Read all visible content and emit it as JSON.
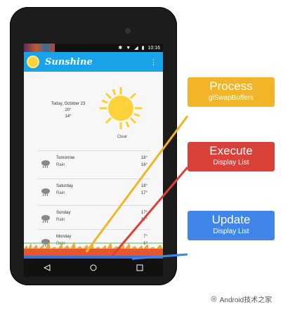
{
  "status": {
    "time": "10:16"
  },
  "app": {
    "title": "Sunshine",
    "menu_icon": "overflow-menu-icon"
  },
  "today": {
    "date": "Today, October 23",
    "high": "20°",
    "low": "14°",
    "condition": "Clear"
  },
  "forecast": [
    {
      "day": "Tomorrow",
      "desc": "Rain",
      "high": "18°",
      "low": "16°"
    },
    {
      "day": "Saturday",
      "desc": "Rain",
      "high": "18°",
      "low": "17°"
    },
    {
      "day": "Sunday",
      "desc": "Rain",
      "high": "17°",
      "low": "17°"
    },
    {
      "day": "Monday",
      "desc": "Rain",
      "high": "7°",
      "low": "6°"
    }
  ],
  "callouts": [
    {
      "title": "Process",
      "subtitle": "glSwapBuffers",
      "color": "#f2b429"
    },
    {
      "title": "Execute",
      "subtitle": "Display List",
      "color": "#d94238"
    },
    {
      "title": "Update",
      "subtitle": "Display List",
      "color": "#3f86e8"
    }
  ],
  "watermark": "Android技术之家"
}
